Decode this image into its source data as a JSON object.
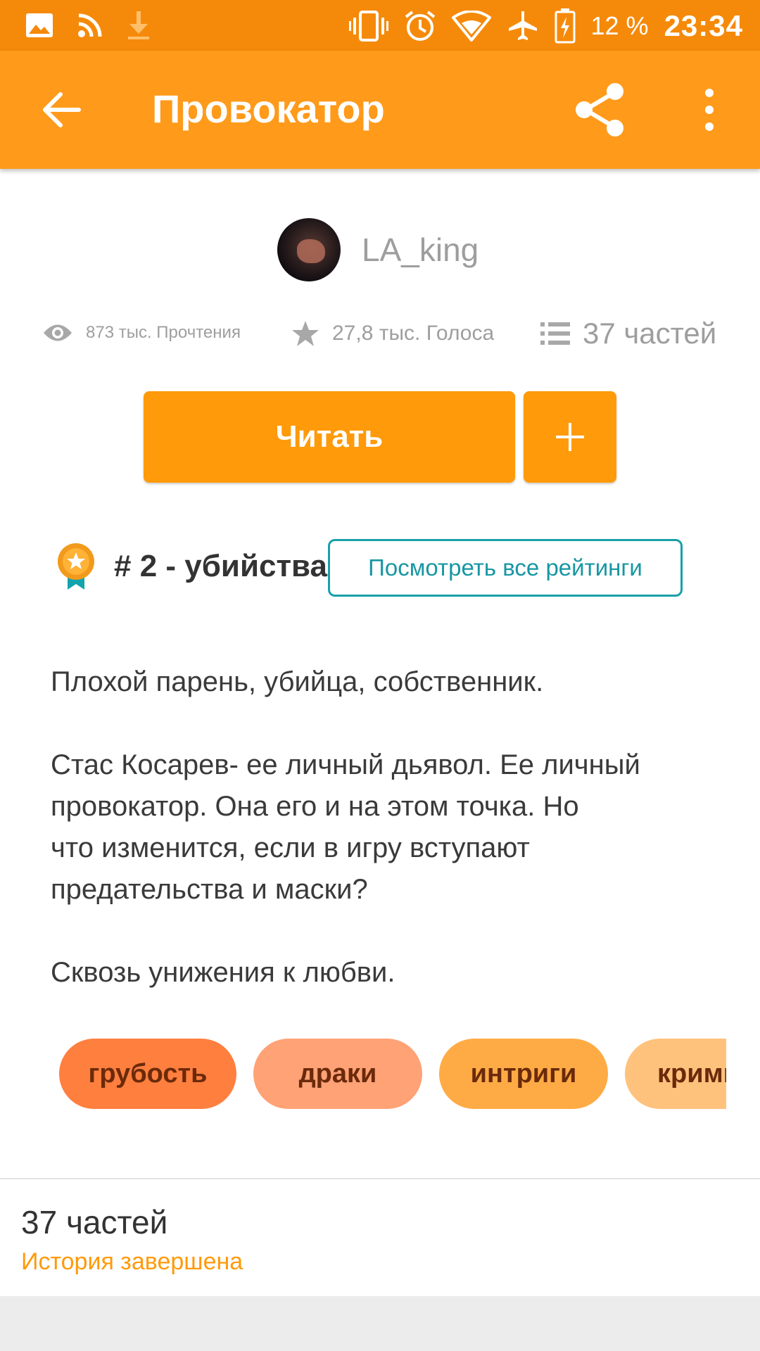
{
  "status_bar": {
    "battery_percent": "12 %",
    "time": "23:34",
    "icons": [
      "image-icon",
      "rss-icon",
      "download-icon",
      "vibrate-icon",
      "alarm-icon",
      "wifi-icon",
      "airplane-icon",
      "battery-icon"
    ]
  },
  "app_bar": {
    "title": "Провокатор",
    "back_icon": "arrow-left-icon",
    "share_icon": "share-icon",
    "more_icon": "more-vert-icon",
    "color": "#ff9a1a"
  },
  "author": {
    "name": "LA_king"
  },
  "stats": {
    "reads": "873 тыс. Прочтения",
    "votes": "27,8 тыс. Голоса",
    "parts": "37 частей"
  },
  "actions": {
    "read_label": "Читать",
    "add_label": "+"
  },
  "ranking": {
    "label": "# 2 - убийства",
    "view_all_label": "Посмотреть все рейтинги",
    "accent": "#18a0a8"
  },
  "description": {
    "lines": [
      "Плохой парень, убийца, собственник.",
      "",
      "Стас Косарев- ее личный дьявол. Ее личный",
      "провокатор. Она его и на этом точка. Но",
      "что изменится, если в игру вступают",
      "предательства и маски?",
      "",
      "Сквозь унижения к любви."
    ]
  },
  "tags": [
    {
      "label": "грубость",
      "color": "#ff7f3f"
    },
    {
      "label": "драки",
      "color": "#ffa276"
    },
    {
      "label": "интриги",
      "color": "#ffab45"
    },
    {
      "label": "крими",
      "color": "#ffc27d"
    }
  ],
  "parts_section": {
    "title": "37 частей",
    "status": "История завершена"
  }
}
